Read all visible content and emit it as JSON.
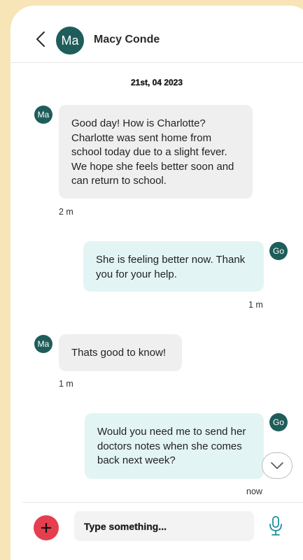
{
  "header": {
    "avatar_initials": "Ma",
    "contact_name": "Macy Conde"
  },
  "date_label": "21st, 04 2023",
  "messages": [
    {
      "direction": "incoming",
      "avatar": "Ma",
      "text": "Good day! How is Charlotte? Charlotte was sent home from school today due to a slight fever. We hope she feels better soon and can return to school.",
      "time": "2 m"
    },
    {
      "direction": "outgoing",
      "avatar": "Go",
      "text": "She is feeling better now. Thank you for your help.",
      "time": "1 m"
    },
    {
      "direction": "incoming",
      "avatar": "Ma",
      "text": "Thats good to know!",
      "time": "1 m"
    },
    {
      "direction": "outgoing",
      "avatar": "Go",
      "text": "Would you need me to send her doctors notes when she comes back next week?",
      "time": "now"
    }
  ],
  "composer": {
    "placeholder": "Type something..."
  },
  "icons": {
    "back": "chevron-left-icon",
    "add": "plus-icon",
    "mic": "microphone-icon",
    "scroll": "chevron-down-icon"
  },
  "colors": {
    "background": "#f7e4b7",
    "avatar": "#1f5d5b",
    "incoming_bubble": "#efefef",
    "outgoing_bubble": "#e3f4f4",
    "add_button": "#e53e4f",
    "mic": "#1f8fa0"
  }
}
